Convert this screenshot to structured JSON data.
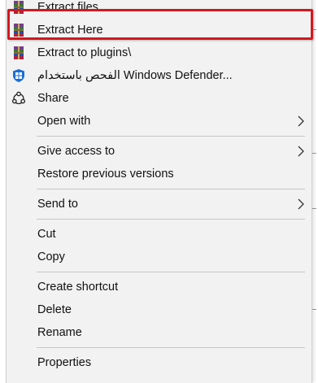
{
  "menu": {
    "items": [
      {
        "label": "Extract files...",
        "icon": "winrar-icon"
      },
      {
        "label": "Extract Here",
        "icon": "winrar-icon"
      },
      {
        "label": "Extract to plugins\\",
        "icon": "winrar-icon"
      },
      {
        "label": "الفحص باستخدام Windows Defender...",
        "icon": "windows-defender-icon"
      },
      {
        "label": "Share",
        "icon": "share-icon"
      },
      {
        "label": "Open with",
        "has_submenu": true
      },
      {
        "label": "Give access to",
        "has_submenu": true
      },
      {
        "label": "Restore previous versions"
      },
      {
        "label": "Send to",
        "has_submenu": true
      },
      {
        "label": "Cut"
      },
      {
        "label": "Copy"
      },
      {
        "label": "Create shortcut"
      },
      {
        "label": "Delete"
      },
      {
        "label": "Rename"
      },
      {
        "label": "Properties"
      }
    ],
    "highlighted_item": "Extract Here",
    "highlight_color": "#d0191f"
  }
}
